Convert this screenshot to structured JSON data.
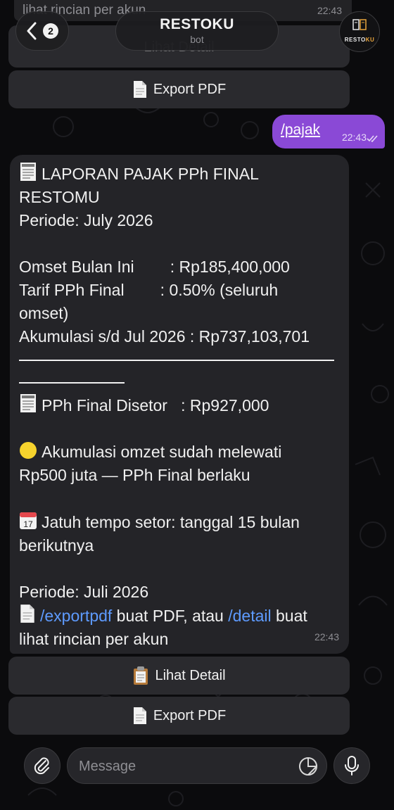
{
  "header": {
    "top_strip_text": "lihat rincian per akun",
    "top_strip_time": "22:43",
    "back_count": "2",
    "title": "RESTOKU",
    "subtitle": "bot",
    "avatar_text_a": "RESTO",
    "avatar_text_b": "KU"
  },
  "buttons_top": {
    "detail_label": "Lihat Detail",
    "export_label": "Export PDF"
  },
  "outgoing": {
    "text": "/pajak",
    "time": "22:43"
  },
  "incoming": {
    "l1": "LAPORAN PAJAK PPh FINAL",
    "l2": "RESTOMU",
    "l3": "Periode: July 2026",
    "l4": "Omset Bulan Ini        : Rp185,400,000",
    "l5": "Tarif PPh Final        : 0.50% (seluruh",
    "l6": "omset)",
    "l7": "Akumulasi s/d Jul 2026 : Rp737,103,701",
    "l8": "PPh Final Disetor   : Rp927,000",
    "l9": "Akumulasi omzet sudah melewati",
    "l10": "Rp500 juta — PPh Final berlaku",
    "l11": "Jatuh tempo setor: tanggal 15 bulan",
    "l12": "berikutnya",
    "l13": "Periode: Juli 2026",
    "cmd_export": "/exportpdf",
    "t_mid": " buat PDF, atau ",
    "cmd_detail": "/detail",
    "t_end": " buat",
    "l15": "lihat rincian per akun",
    "time": "22:43"
  },
  "buttons_bottom": {
    "detail_label": "Lihat Detail",
    "export_label": "Export PDF"
  },
  "composer": {
    "placeholder": "Message"
  },
  "colors": {
    "outgoing_bubble": "#8a49d6",
    "incoming_bubble": "#242428",
    "command_link": "#5e9bff"
  },
  "icons": [
    "back-chevron-icon",
    "receipt-icon",
    "document-icon",
    "clipboard-icon",
    "yellow-circle-icon",
    "calendar-icon",
    "paperclip-icon",
    "sticker-icon",
    "microphone-icon",
    "double-check-icon"
  ]
}
